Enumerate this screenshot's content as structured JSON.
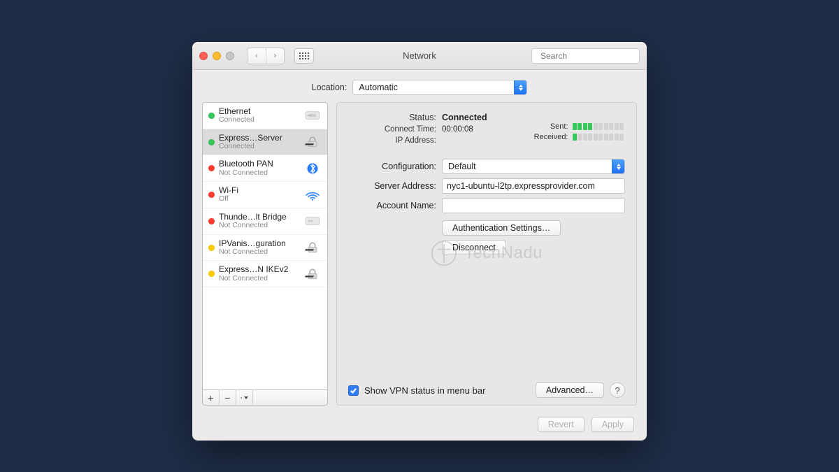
{
  "window": {
    "title": "Network",
    "search_placeholder": "Search"
  },
  "location": {
    "label": "Location:",
    "value": "Automatic"
  },
  "sidebar": {
    "items": [
      {
        "name": "Ethernet",
        "sub": "Connected",
        "status": "green",
        "icon": "ethernet"
      },
      {
        "name": "Express…Server",
        "sub": "Connected",
        "status": "green",
        "icon": "vpn"
      },
      {
        "name": "Bluetooth PAN",
        "sub": "Not Connected",
        "status": "red",
        "icon": "bluetooth"
      },
      {
        "name": "Wi-Fi",
        "sub": "Off",
        "status": "red",
        "icon": "wifi"
      },
      {
        "name": "Thunde…lt Bridge",
        "sub": "Not Connected",
        "status": "red",
        "icon": "thunderbolt"
      },
      {
        "name": "IPVanis…guration",
        "sub": "Not Connected",
        "status": "yellow",
        "icon": "vpn"
      },
      {
        "name": "Express…N IKEv2",
        "sub": "Not Connected",
        "status": "yellow",
        "icon": "vpn"
      }
    ],
    "selected_index": 1,
    "footer": {
      "add": "+",
      "remove": "−"
    }
  },
  "detail": {
    "status_label": "Status:",
    "status_value": "Connected",
    "connect_time_label": "Connect Time:",
    "connect_time_value": "00:00:08",
    "ip_label": "IP Address:",
    "ip_value": "",
    "sent_label": "Sent:",
    "sent_bars_on": 4,
    "received_label": "Received:",
    "received_bars_on": 1,
    "config_label": "Configuration:",
    "config_value": "Default",
    "server_label": "Server Address:",
    "server_value": "nyc1-ubuntu-l2tp.expressprovider.com",
    "account_label": "Account Name:",
    "account_value": "",
    "auth_button": "Authentication Settings…",
    "disconnect_button": "Disconnect",
    "checkbox_label": "Show VPN status in menu bar",
    "checkbox_checked": true,
    "advanced_button": "Advanced…",
    "help": "?"
  },
  "bottom": {
    "revert": "Revert",
    "apply": "Apply"
  },
  "watermark": "TechNadu"
}
